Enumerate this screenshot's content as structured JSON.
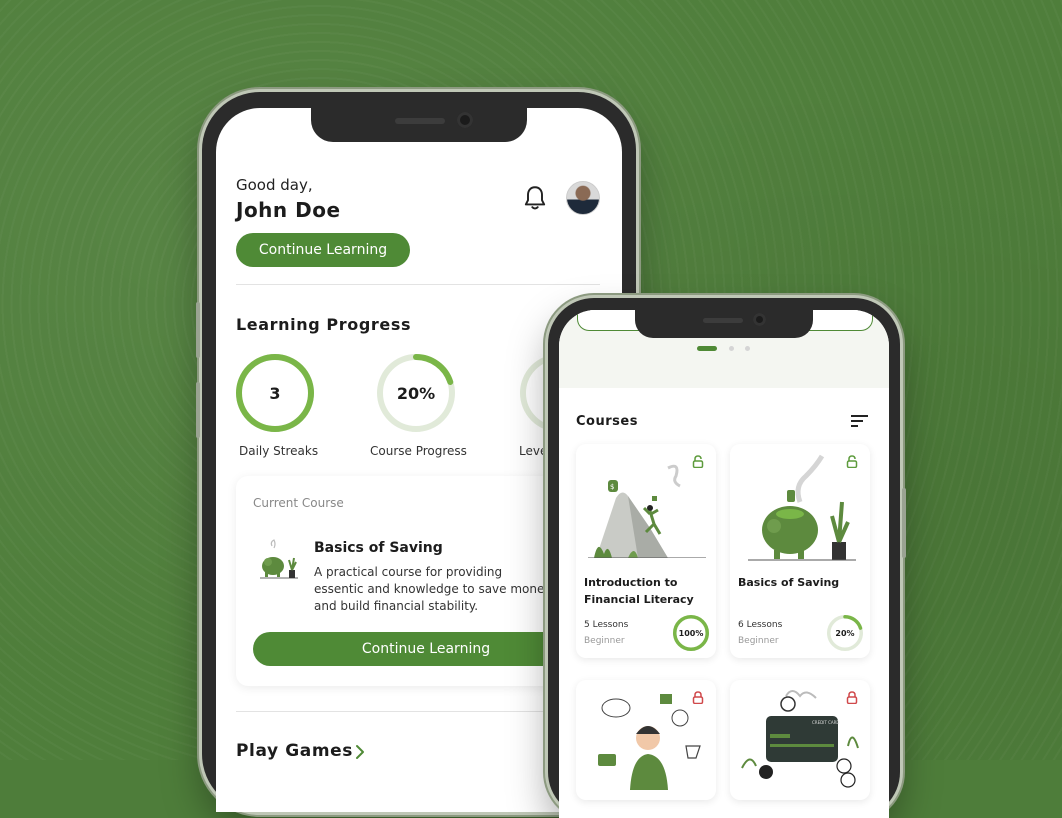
{
  "colors": {
    "accent": "#4f8a36",
    "ring_light": "#e1ead9",
    "ring_green": "#7ab648",
    "lock_open": "#5d9b3c",
    "lock_closed": "#d0494b"
  },
  "home": {
    "greeting": "Good day,",
    "user_name": "John Doe",
    "continue_button": "Continue Learning",
    "learning_progress": {
      "title": "Learning Progress",
      "stats": [
        {
          "value": "3",
          "label": "Daily Streaks",
          "progress": 1.0
        },
        {
          "value": "20%",
          "label": "Course Progress",
          "progress": 0.2
        },
        {
          "value": "",
          "label": "Leve",
          "progress": 0.3
        }
      ]
    },
    "current_course": {
      "heading": "Current Course",
      "title": "Basics of Saving",
      "description": "A practical course for providing essentic and knowledge to save money and build financial stability.",
      "button": "Continue Learning"
    },
    "play_games": {
      "title": "Play Games"
    }
  },
  "courses_screen": {
    "title": "Courses",
    "carousel_active": 0,
    "courses": [
      {
        "title": "Introduction to Financial Literacy",
        "lessons": "5 Lessons",
        "level": "Beginner",
        "progress_label": "100%",
        "progress": 1.0,
        "locked": false
      },
      {
        "title": "Basics of Saving",
        "lessons": "6 Lessons",
        "level": "Beginner",
        "progress_label": "20%",
        "progress": 0.2,
        "locked": false
      },
      {
        "title": "",
        "lessons": "",
        "level": "",
        "progress_label": "",
        "progress": 0,
        "locked": true
      },
      {
        "title": "",
        "lessons": "",
        "level": "",
        "progress_label": "",
        "progress": 0,
        "locked": true
      }
    ]
  }
}
